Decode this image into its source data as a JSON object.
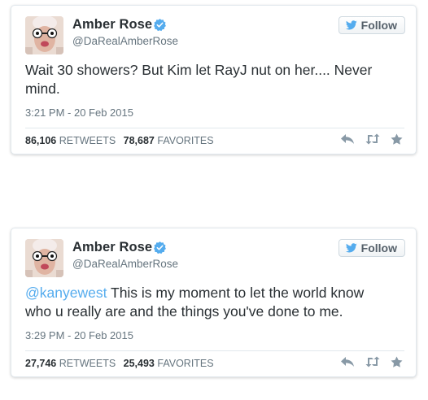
{
  "tweets": [
    {
      "name": "Amber Rose",
      "handle": "@DaRealAmberRose",
      "follow_label": "Follow",
      "text_mention": "",
      "text": "Wait 30 showers? But Kim let RayJ nut on her.... Never mind.",
      "timestamp": "3:21 PM - 20 Feb 2015",
      "retweets_count": "86,106",
      "retweets_label": "RETWEETS",
      "favorites_count": "78,687",
      "favorites_label": "FAVORITES"
    },
    {
      "name": "Amber Rose",
      "handle": "@DaRealAmberRose",
      "follow_label": "Follow",
      "text_mention": "@kanyewest",
      "text": " This is my moment to let the world know who u really are and the things you've done to me.",
      "timestamp": "3:29 PM - 20 Feb 2015",
      "retweets_count": "27,746",
      "retweets_label": "RETWEETS",
      "favorites_count": "25,493",
      "favorites_label": "FAVORITES"
    }
  ],
  "colors": {
    "link": "#55acee",
    "verified": "#55acee",
    "text": "#292f33",
    "muted": "#66757f",
    "border": "#e1e8ed"
  },
  "icons": [
    "avatar-photo",
    "verified-badge-icon",
    "twitter-bird-icon",
    "reply-icon",
    "retweet-icon",
    "favorite-star-icon"
  ]
}
